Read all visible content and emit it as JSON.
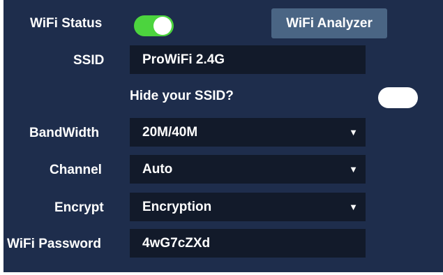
{
  "wifi_status": {
    "label": "WiFi Status",
    "enabled": true
  },
  "wifi_analyzer": {
    "label": "WiFi Analyzer"
  },
  "ssid": {
    "label": "SSID",
    "value": "ProWiFi 2.4G"
  },
  "hide_ssid": {
    "label": "Hide your SSID?",
    "enabled": false
  },
  "bandwidth": {
    "label": "BandWidth",
    "value": "20M/40M"
  },
  "channel": {
    "label": "Channel",
    "value": "Auto"
  },
  "encrypt": {
    "label": "Encrypt",
    "value": "Encryption"
  },
  "password": {
    "label": "WiFi Password",
    "value": "4wG7cZXd"
  },
  "dropdown_caret": "▼",
  "colors": {
    "panel_bg": "#1e2d4c",
    "field_bg": "#121a2a",
    "toggle_on": "#4cd43e",
    "button_bg": "#4a6584"
  }
}
